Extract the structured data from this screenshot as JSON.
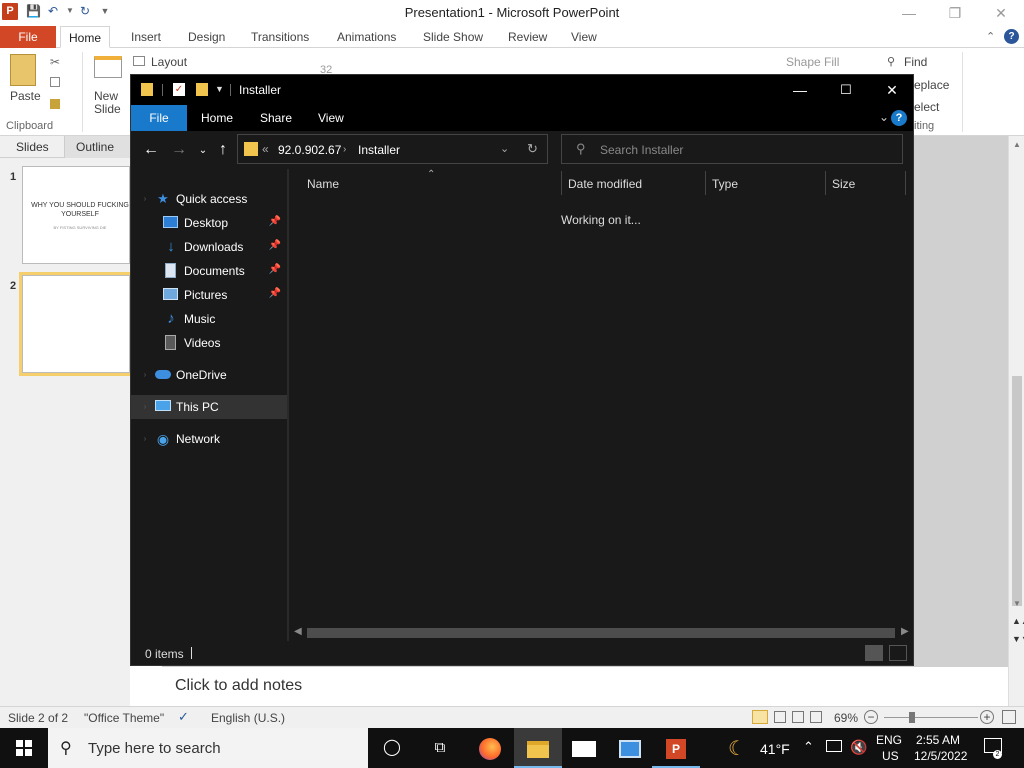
{
  "powerpoint": {
    "logo": "P",
    "title": "Presentation1 - Microsoft PowerPoint",
    "tabs": [
      "File",
      "Home",
      "Insert",
      "Design",
      "Transitions",
      "Animations",
      "Slide Show",
      "Review",
      "View"
    ],
    "ribbon": {
      "paste": "Paste",
      "new_slide": "New Slide",
      "layout": "Layout",
      "font_size": "32",
      "shape_fill": "Shape Fill",
      "find": "Find",
      "replace": "eplace",
      "select": "elect",
      "clipboard": "Clipboard",
      "editing": "iting"
    },
    "pane_tabs": [
      "Slides",
      "Outline"
    ],
    "slides": [
      {
        "num": "1",
        "title": "WHY YOU SHOULD FUCKING YOURSELF",
        "subtitle": "BY FISTING SURVIVING DIE"
      },
      {
        "num": "2"
      }
    ],
    "notes_placeholder": "Click to add notes",
    "status": {
      "slide": "Slide 2 of 2",
      "theme": "\"Office Theme\"",
      "language": "English (U.S.)",
      "zoom": "69%"
    }
  },
  "explorer": {
    "title": "Installer",
    "ribbon_tabs": [
      "File",
      "Home",
      "Share",
      "View"
    ],
    "help": "?",
    "address": {
      "overflow": "«",
      "segments": [
        "92.0.902.67",
        "Installer"
      ]
    },
    "search_placeholder": "Search Installer",
    "nav": {
      "quick_access": "Quick access",
      "desktop": "Desktop",
      "downloads": "Downloads",
      "documents": "Documents",
      "pictures": "Pictures",
      "music": "Music",
      "videos": "Videos",
      "onedrive": "OneDrive",
      "this_pc": "This PC",
      "network": "Network"
    },
    "columns": [
      "Name",
      "Date modified",
      "Type",
      "Size"
    ],
    "loading_text": "Working on it...",
    "item_count": "0 items"
  },
  "taskbar": {
    "search_placeholder": "Type here to search",
    "weather": "41°F",
    "lang_top": "ENG",
    "lang_bottom": "US",
    "time": "2:55 AM",
    "date": "12/5/2022"
  },
  "colors": {
    "ppt_accent": "#d24726",
    "explorer_accent": "#1979ca",
    "folder": "#f0c44d"
  }
}
